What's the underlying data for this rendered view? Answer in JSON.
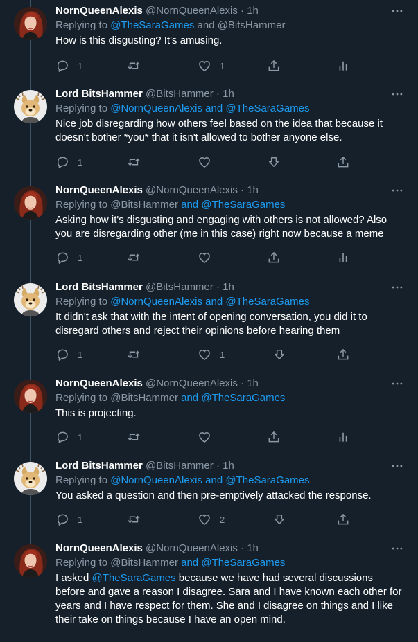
{
  "theme": {
    "background": "#15202b",
    "text": "#ffffff",
    "secondary_text": "#8b98a5",
    "link": "#1d9bf0",
    "thread_line": "#3d5466"
  },
  "tweets": [
    {
      "display_name": "NornQueenAlexis",
      "handle": "@NornQueenAlexis",
      "dot": "·",
      "time": "1h",
      "replying_prefix": "Replying to ",
      "reply_mention_1": "@TheSaraGames",
      "reply_middle": " and ",
      "reply_mention_2": "@BitsHammer",
      "body": "How is this disgusting?  It's amusing.",
      "reply_count": "1",
      "retweet_count": "",
      "like_count": "1",
      "avatar_icon": "red-hair-woman-avatar",
      "right_icon": "analytics-icon"
    },
    {
      "display_name": "Lord BitsHammer",
      "handle": "@BitsHammer",
      "dot": "·",
      "time": "1h",
      "replying_prefix": "Replying to ",
      "reply_mention_1": "@NornQueenAlexis",
      "reply_middle": " and ",
      "reply_mention_2": "@TheSaraGames",
      "body": "Nice job disregarding how others feel based on the idea that because it doesn't bother *you* that it isn't allowed to bother anyone else.",
      "reply_count": "1",
      "retweet_count": "",
      "like_count": "",
      "avatar_icon": "doge-avatar",
      "right_icon": "share-icon"
    },
    {
      "display_name": "NornQueenAlexis",
      "handle": "@NornQueenAlexis",
      "dot": "·",
      "time": "1h",
      "replying_prefix": "Replying to ",
      "reply_mention_1": "@BitsHammer",
      "reply_middle": " and ",
      "reply_mention_2": "@TheSaraGames",
      "body": "Asking how it's disgusting and engaging with others is not allowed? Also you are disregarding other (me in this case) right now because a meme",
      "reply_count": "1",
      "retweet_count": "",
      "like_count": "",
      "avatar_icon": "red-hair-woman-avatar",
      "right_icon": "analytics-icon"
    },
    {
      "display_name": "Lord BitsHammer",
      "handle": "@BitsHammer",
      "dot": "·",
      "time": "1h",
      "replying_prefix": "Replying to ",
      "reply_mention_1": "@NornQueenAlexis",
      "reply_middle": " and ",
      "reply_mention_2": "@TheSaraGames",
      "body": "It didn't ask that with the intent of opening conversation, you did it to disregard others and reject their opinions before hearing them",
      "reply_count": "1",
      "retweet_count": "",
      "like_count": "1",
      "avatar_icon": "doge-avatar",
      "right_icon": "share-icon"
    },
    {
      "display_name": "NornQueenAlexis",
      "handle": "@NornQueenAlexis",
      "dot": "·",
      "time": "1h",
      "replying_prefix": "Replying to ",
      "reply_mention_1": "@BitsHammer",
      "reply_middle": " and ",
      "reply_mention_2": "@TheSaraGames",
      "body": "This is projecting.",
      "reply_count": "1",
      "retweet_count": "",
      "like_count": "",
      "avatar_icon": "red-hair-woman-avatar",
      "right_icon": "analytics-icon"
    },
    {
      "display_name": "Lord BitsHammer",
      "handle": "@BitsHammer",
      "dot": "·",
      "time": "1h",
      "replying_prefix": "Replying to ",
      "reply_mention_1": "@NornQueenAlexis",
      "reply_middle": " and ",
      "reply_mention_2": "@TheSaraGames",
      "body": "You asked a question and then pre-emptively attacked the response.",
      "reply_count": "1",
      "retweet_count": "",
      "like_count": "2",
      "avatar_icon": "doge-avatar",
      "right_icon": "share-icon"
    },
    {
      "display_name": "NornQueenAlexis",
      "handle": "@NornQueenAlexis",
      "dot": "·",
      "time": "1h",
      "replying_prefix": "Replying to ",
      "reply_mention_1": "@BitsHammer",
      "reply_middle": " and ",
      "reply_mention_2": "@TheSaraGames",
      "body_before": "I asked ",
      "body_mention": "@TheSaraGames",
      "body_after": " because we have had several discussions before and gave a reason I disagree. Sara and I have known each other for years and I have respect for them. She and I disagree on things and I like their take on things because I have an open mind.",
      "avatar_icon": "red-hair-woman-avatar"
    }
  ]
}
